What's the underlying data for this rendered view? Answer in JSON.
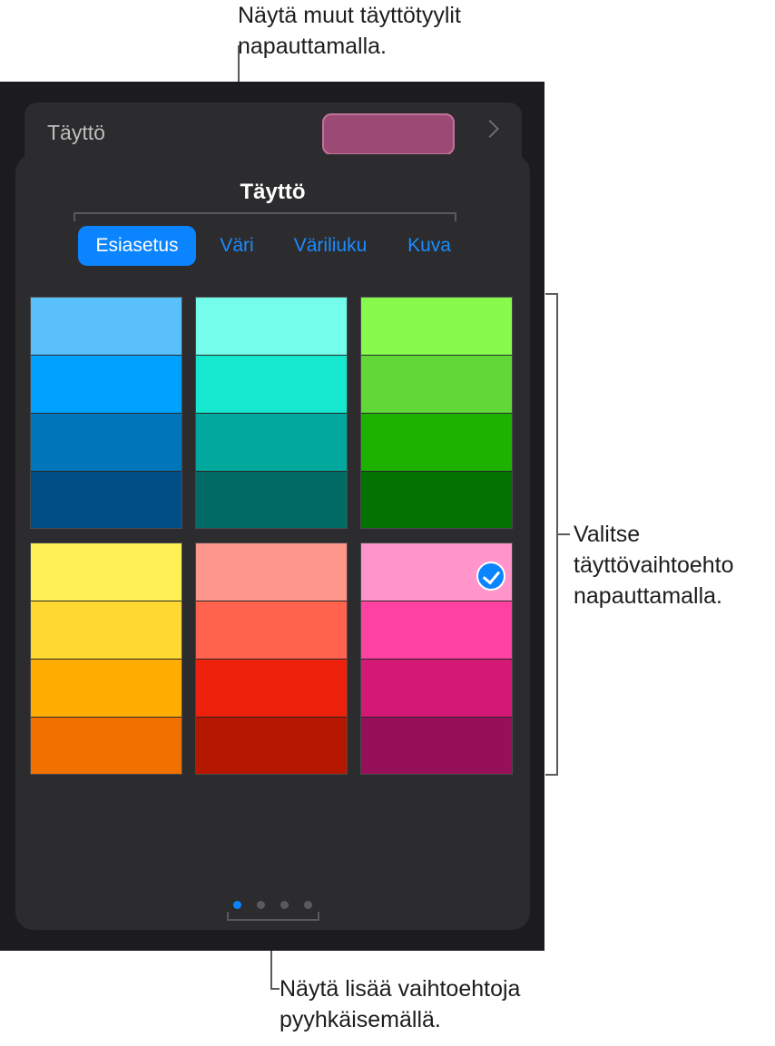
{
  "callouts": {
    "top": [
      "Näytä muut täyttötyylit",
      "napauttamalla."
    ],
    "right": [
      "Valitse",
      "täyttövaihtoehto",
      "napauttamalla."
    ],
    "bottom": [
      "Näytä lisää vaihtoehtoja",
      "pyyhkäisemällä."
    ]
  },
  "fill_row": {
    "label": "Täyttö",
    "current_color": "#9a4a74"
  },
  "popover": {
    "title": "Täyttö",
    "tabs": [
      {
        "label": "Esiasetus",
        "active": true
      },
      {
        "label": "Väri",
        "active": false
      },
      {
        "label": "Väriliuku",
        "active": false
      },
      {
        "label": "Kuva",
        "active": false
      }
    ],
    "swatch_groups": [
      {
        "name": "blue",
        "colors": [
          "#5ac0fb",
          "#00a2ff",
          "#0076ba",
          "#004e86"
        ],
        "selected": false
      },
      {
        "name": "teal",
        "colors": [
          "#73fdea",
          "#16e7cf",
          "#00a89d",
          "#006c65"
        ],
        "selected": false
      },
      {
        "name": "green",
        "colors": [
          "#88fa4e",
          "#61d837",
          "#1db100",
          "#017100"
        ],
        "selected": false
      },
      {
        "name": "yellow",
        "colors": [
          "#fff056",
          "#ffd932",
          "#ffae00",
          "#f07100"
        ],
        "selected": false
      },
      {
        "name": "red",
        "colors": [
          "#ff968c",
          "#ff634d",
          "#ee220c",
          "#b51700"
        ],
        "selected": false
      },
      {
        "name": "pink",
        "colors": [
          "#ff95ca",
          "#ff42a1",
          "#d41876",
          "#961059"
        ],
        "selected": true
      }
    ],
    "page_dots": {
      "count": 4,
      "active_index": 0
    },
    "accent_color": "#0a84ff"
  }
}
